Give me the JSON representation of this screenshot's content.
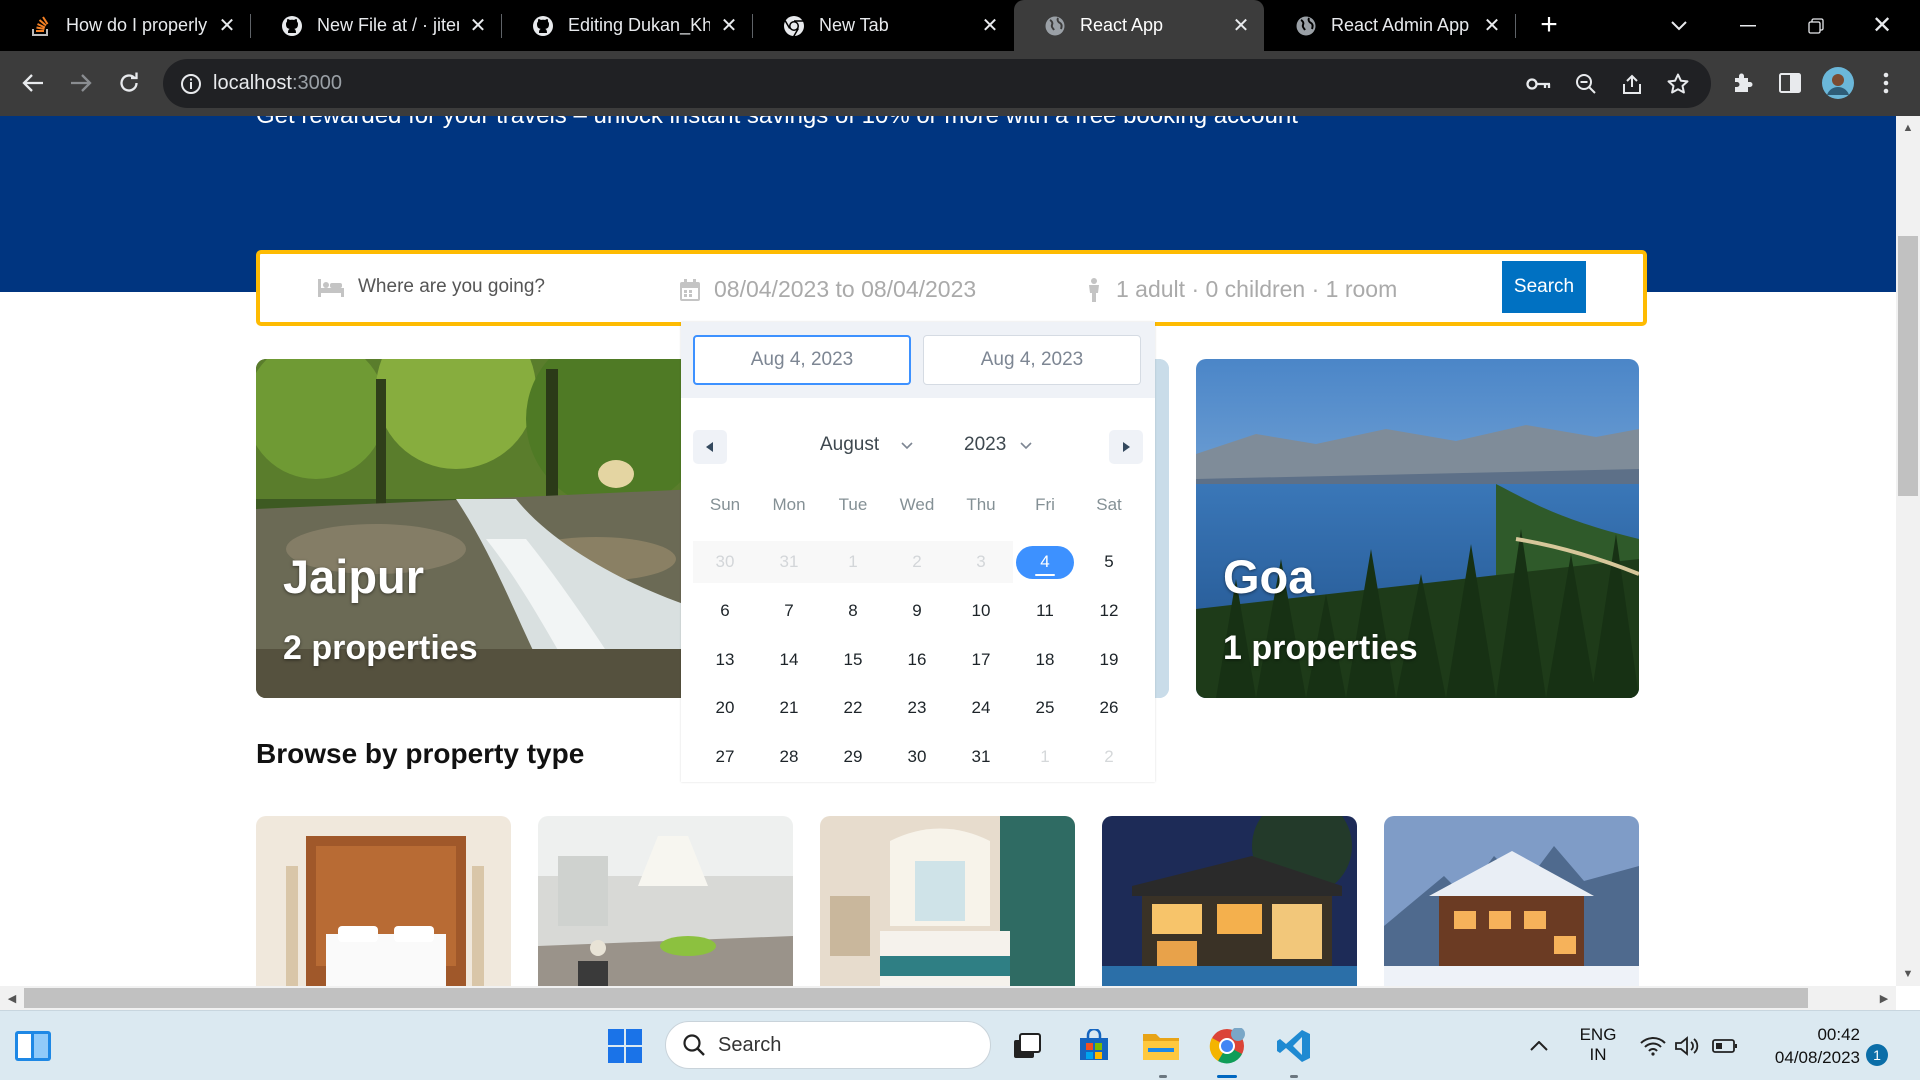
{
  "browser": {
    "tabs": [
      {
        "title": "How do I properly f",
        "icon": "stackoverflow-icon",
        "active": false
      },
      {
        "title": "New File at / · jitend",
        "icon": "github-icon",
        "active": false
      },
      {
        "title": "Editing Dukan_Khat",
        "icon": "github-icon",
        "active": false
      },
      {
        "title": "New Tab",
        "icon": "chrome-icon",
        "active": false
      },
      {
        "title": "React App",
        "icon": "globe-icon",
        "active": true
      },
      {
        "title": "React Admin App",
        "icon": "globe-icon",
        "active": false
      }
    ],
    "url_host": "localhost",
    "url_port": ":3000"
  },
  "page": {
    "hero_text": "Get rewarded for your travels – unlock instant savings of 10% or more with a free booking account",
    "search": {
      "destination_placeholder": "Where are you going?",
      "date_range": "08/04/2023 to 08/04/2023",
      "guests": "1 adult · 0 children · 1 room",
      "button": "Search"
    },
    "featured": [
      {
        "city": "Jaipur",
        "count": "2 properties"
      },
      {
        "city": "Goa",
        "count": "1 properties"
      }
    ],
    "section_title": "Browse by property type",
    "property_types": [
      "hotel-image",
      "apartment-image",
      "resort-image",
      "villa-image",
      "cabin-image"
    ]
  },
  "datepicker": {
    "start_input": "Aug 4, 2023",
    "end_input": "Aug 4, 2023",
    "month": "August",
    "year": "2023",
    "weekdays": [
      "Sun",
      "Mon",
      "Tue",
      "Wed",
      "Thu",
      "Fri",
      "Sat"
    ],
    "weeks": [
      [
        "30",
        "31",
        "1",
        "2",
        "3",
        "4",
        "5"
      ],
      [
        "6",
        "7",
        "8",
        "9",
        "10",
        "11",
        "12"
      ],
      [
        "13",
        "14",
        "15",
        "16",
        "17",
        "18",
        "19"
      ],
      [
        "20",
        "21",
        "22",
        "23",
        "24",
        "25",
        "26"
      ],
      [
        "27",
        "28",
        "29",
        "30",
        "31",
        "1",
        "2"
      ]
    ],
    "selected_day": "4"
  },
  "taskbar": {
    "search_label": "Search",
    "language": "ENG",
    "region": "IN",
    "time": "00:42",
    "date": "04/08/2023",
    "notification_count": "1"
  },
  "colors": {
    "hero": "#003580",
    "search_border": "#febb02",
    "search_button": "#0071c2",
    "calendar_accent": "#3d91ff"
  }
}
